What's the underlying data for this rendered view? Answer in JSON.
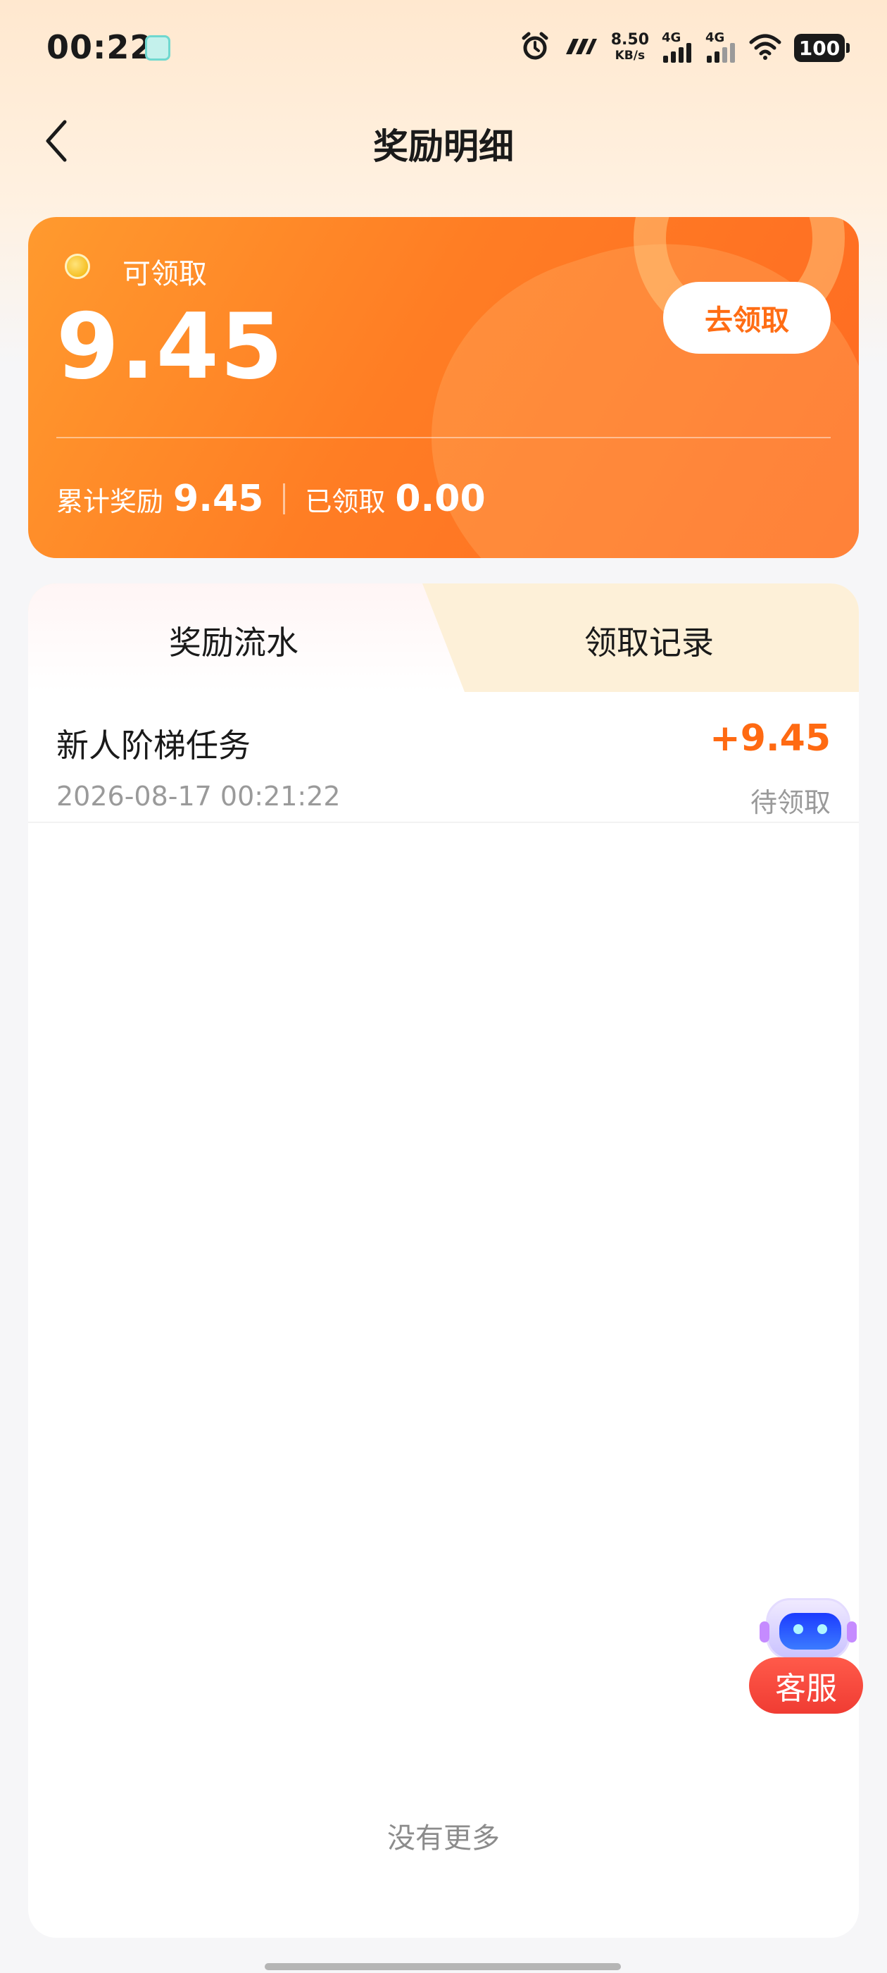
{
  "status_bar": {
    "time": "00:22",
    "net_speed": "8.50",
    "net_speed_unit": "KB/s",
    "signal1": "4G",
    "signal2": "4G",
    "battery": "100"
  },
  "header": {
    "title": "奖励明细"
  },
  "reward_card": {
    "claimable_label": "可领取",
    "claimable_amount": "9.45",
    "claim_button": "去领取",
    "total_label": "累计奖励",
    "total_value": "9.45",
    "claimed_label": "已领取",
    "claimed_value": "0.00"
  },
  "tabs": [
    {
      "label": "奖励流水",
      "active": true
    },
    {
      "label": "领取记录",
      "active": false
    }
  ],
  "records": [
    {
      "title": "新人阶梯任务",
      "time": "2026-08-17 00:21:22",
      "amount": "+9.45",
      "status": "待领取"
    }
  ],
  "footer": {
    "no_more": "没有更多"
  },
  "customer_service": {
    "label": "客服"
  },
  "colors": {
    "accent": "#ff6a12",
    "card_start": "#ff9a2e",
    "card_end": "#ff6a22",
    "cs_red": "#f03c33"
  }
}
